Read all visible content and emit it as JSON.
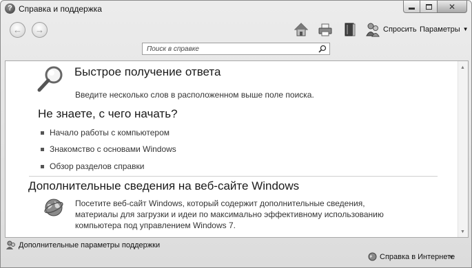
{
  "window": {
    "title": "Справка и поддержка"
  },
  "toolbar": {
    "back_glyph": "←",
    "forward_glyph": "→",
    "icons": [
      "home-icon",
      "print-icon",
      "browse-help-icon",
      "ask-icon"
    ],
    "ask_label": "Спросить",
    "options_label": "Параметры",
    "options_caret": "▼"
  },
  "search": {
    "placeholder": "Поиск в справке"
  },
  "quick_answer": {
    "title": "Быстрое получение ответа",
    "description": "Введите несколько слов в расположенном выше поле поиска."
  },
  "start": {
    "title": "Не знаете, с чего начать?",
    "links": [
      "Начало работы с компьютером",
      "Знакомство с основами Windows",
      "Обзор разделов справки"
    ]
  },
  "web": {
    "title": "Дополнительные сведения на веб-сайте Windows",
    "lines": [
      "Посетите веб-сайт Windows, который содержит дополнительные сведения,",
      "материалы для загрузки и идеи по максимально эффективному использованию",
      "компьютера под управлением Windows 7."
    ]
  },
  "status": {
    "more_support_label": "Дополнительные параметры поддержки",
    "online_help_label": "Справка в Интернете",
    "online_caret": "▼"
  },
  "scrollbar": {
    "up_glyph": "▲",
    "down_glyph": "▼"
  },
  "colors": {
    "chrome": "#dcdcdc",
    "content_bg": "#ffffff",
    "text": "#333333"
  }
}
